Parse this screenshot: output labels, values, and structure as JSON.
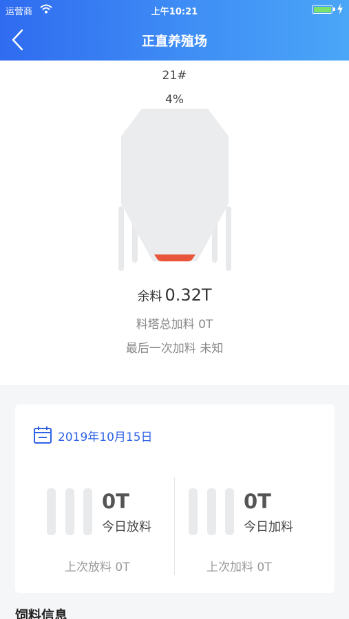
{
  "status_bar": {
    "carrier": "运营商",
    "time": "上午10:21"
  },
  "nav": {
    "title": "正直养殖场"
  },
  "silo": {
    "number": "21#",
    "percent": "4%",
    "fill_fraction": 0.04,
    "remain_label": "余料",
    "remain_value": "0.32T",
    "total_add": "料塔总加料 0T",
    "last_add": "最后一次加料 未知"
  },
  "card": {
    "date": "2019年10月15日",
    "discharge": {
      "value": "0T",
      "label": "今日放料",
      "last": "上次放料 0T"
    },
    "feed": {
      "value": "0T",
      "label": "今日加料",
      "last": "上次加料 0T"
    }
  },
  "feed_info": {
    "heading": "饲料信息"
  },
  "colors": {
    "accent": "#2f62e6",
    "fill_level": "#e8553a",
    "battery": "#7be36d"
  }
}
